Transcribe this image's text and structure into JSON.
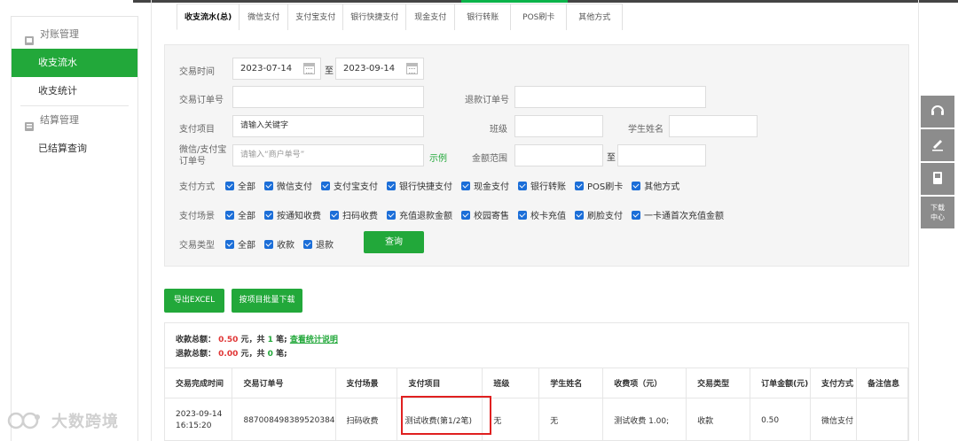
{
  "sidebar": {
    "group1": "对账管理",
    "items1": [
      "收支流水",
      "收支统计"
    ],
    "group2": "结算管理",
    "items2": [
      "已结算查询"
    ]
  },
  "tabs": [
    "收支流水(总)",
    "微信支付",
    "支付宝支付",
    "银行快捷支付",
    "现金支付",
    "银行转账",
    "POS刷卡",
    "其他方式"
  ],
  "filter": {
    "trade_time_label": "交易时间",
    "date_from": "2023-07-14",
    "date_to_sep": "至",
    "date_to": "2023-09-14",
    "order_no_label": "交易订单号",
    "refund_no_label": "退款订单号",
    "pay_item_label": "支付项目",
    "pay_item_value": "请输入关键字",
    "class_label": "班级",
    "student_label": "学生姓名",
    "wx_order_label": "微信/支付宝订单号",
    "wx_order_placeholder": "请输入“商户单号”",
    "example_link": "示例",
    "amount_label": "金额范围",
    "amount_sep": "至",
    "pay_method_label": "支付方式",
    "pay_methods": [
      "全部",
      "微信支付",
      "支付宝支付",
      "银行快捷支付",
      "现金支付",
      "银行转账",
      "POS刷卡",
      "其他方式"
    ],
    "pay_scene_label": "支付场景",
    "pay_scenes": [
      "全部",
      "按通知收费",
      "扫码收费",
      "充值退款金额",
      "校园寄售",
      "校卡充值",
      "刷脸支付",
      "一卡通首次充值金额"
    ],
    "trade_type_label": "交易类型",
    "trade_types": [
      "全部",
      "收款",
      "退款"
    ],
    "query_button": "查询"
  },
  "actions": {
    "export_excel": "导出EXCEL",
    "batch_download": "按项目批量下载"
  },
  "summary": {
    "income_label": "收款总额：",
    "income_amount": "0.50",
    "income_unit": "元，共",
    "income_count": "1",
    "income_count_unit": "笔;",
    "detail_link": "查看统计说明",
    "refund_label": "退款总额：",
    "refund_amount": "0.00",
    "refund_unit": "元，共",
    "refund_count": "0",
    "refund_count_unit": "笔;"
  },
  "table": {
    "headers": [
      "交易完成时间",
      "交易订单号",
      "支付场景",
      "支付项目",
      "班级",
      "学生姓名",
      "收费项（元）",
      "交易类型",
      "订单金额(元)",
      "支付方式",
      "备注信息"
    ],
    "rows": [
      [
        "2023-09-14 16:15:20",
        "887008498389520384",
        "扫码收费",
        "测试收费(第1/2笔)",
        "无",
        "无",
        "测试收费 1.00;",
        "收款",
        "0.50",
        "微信支付",
        ""
      ]
    ]
  },
  "floatbar": {
    "download_center": "下载中心"
  },
  "watermark": "大数跨境",
  "colors": {
    "accent_green": "#22a83a",
    "checkbox_blue": "#1b6ed8",
    "amount_red": "#e03636",
    "highlight_box": "#e02020"
  }
}
